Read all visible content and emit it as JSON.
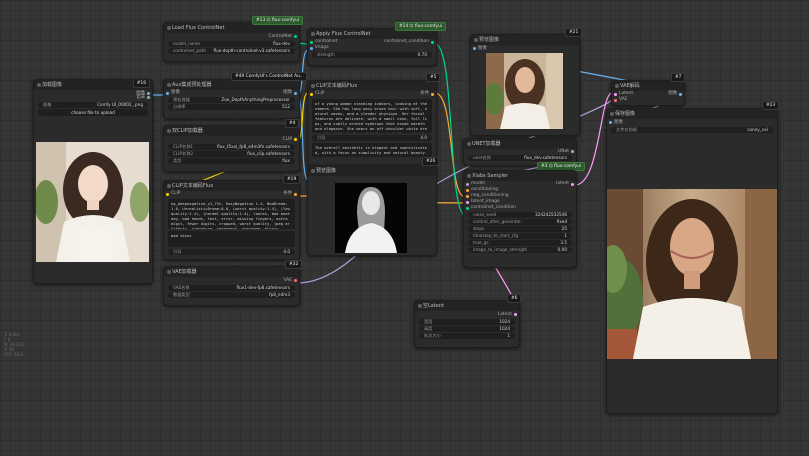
{
  "canvas": {
    "info_lines": [
      "T: 0.00s",
      "I: 0",
      "N: 16 [16]",
      "V: 46",
      "FPS: 58.8"
    ]
  },
  "nodes": {
    "load_image": {
      "title": "加载图像",
      "badge": "#16",
      "outputs": [
        "图像",
        "遮罩"
      ],
      "image_label": "图像",
      "image_value": "Comfy UI_00002_.png",
      "upload_label": "choose file to upload"
    },
    "load_controlnet": {
      "title": "Load Flux ControlNet",
      "badge": "#13 ⌬ flux-comfyui",
      "output": "ControlNet",
      "widgets": [
        {
          "label": "model_name",
          "value": "flux-dev"
        },
        {
          "label": "controlnet_path",
          "value": "flux-depth-controlnet-v3.safetensors"
        }
      ]
    },
    "aux_preprocessor": {
      "title": "Aux集成预处理器",
      "badge": "#49 ComfyUI's ControlNet Au..",
      "input": "图像",
      "output": "图像",
      "widgets": [
        {
          "label": "预处理器",
          "value": "Zoe_DepthAnythingPreprocessor"
        },
        {
          "label": "分辨率",
          "value": "512"
        }
      ]
    },
    "dual_clip": {
      "title": "双CLIP加载器",
      "badge": "#4",
      "output": "CLIP",
      "widgets": [
        {
          "label": "CLIP名称1",
          "value": "flux_t5xxl_fp8_e4m3fn.safetensors"
        },
        {
          "label": "CLIP名称2",
          "value": "flux_clip.safetensors"
        },
        {
          "label": "类型",
          "value": "flux"
        }
      ]
    },
    "clip_encode_neg": {
      "title": "CLIP文本编码Flux",
      "badge": "#19",
      "input": "CLIP",
      "output": "条件",
      "text1": "ng_deepnegative_v1_75t, EasyNegative 1.4, BadDream:1.0, UnrealisticDream:0.8, (worst quality:1.4), (low quality:1.4), (normal quality:1.4), lowres, bad anatomy, bad hands, text, error, missing fingers, extra digit, fewer digits, cropped, worst quality, jpeg artifacts, signature, watermark, username, blurry",
      "text2": "bad skins",
      "guidance_label": "引导",
      "guidance_value": "4.0"
    },
    "vae_loader": {
      "title": "VAE加载器",
      "badge": "#32",
      "output": "VAE",
      "widgets": [
        {
          "label": "VAE名称",
          "value": "flux1-dev-fp8.safetensors"
        },
        {
          "label": "数据类型",
          "value": "fp8_e4m3"
        }
      ]
    },
    "apply_controlnet": {
      "title": "Apply Flux ControlNet",
      "badge": "#14 ⌬ flux-comfyui",
      "inputs": [
        "controlnet",
        "image"
      ],
      "output": "controlnet_condition",
      "widget": {
        "label": "strength",
        "value": "0.70"
      }
    },
    "clip_encode_pos": {
      "title": "CLIP文本编码Flux",
      "badge": "#5",
      "input": "CLIP",
      "output": "条件",
      "text1": "of a young woman standing indoors, looking at the camera. She has long wavy brown hair with soft, natural waves, and a slender physique. Her facial features are delicate, with a small nose, full lips, and subtly arched eyebrows that exude warmth and elegance. She wears an off-shoulder white dress with delicate lace details, including a touch of pearl buttons",
      "text2": "The overall aesthetic is elegant and sophisticated, with a focus on simplicity and natural beauty.",
      "guidance_label": "引导",
      "guidance_value": "4.0"
    },
    "preview_depth": {
      "title": "预览图像",
      "badge": "#26"
    },
    "preview_top": {
      "title": "预览图像",
      "badge": "#21",
      "input": "图像"
    },
    "vae_decode": {
      "title": "VAE解码",
      "badge": "#7",
      "inputs": [
        "Latent",
        "VAE"
      ],
      "output": "图像"
    },
    "unet_loader": {
      "title": "UNET加载器",
      "badge": "#3 ⌬ flux-comfyui",
      "output": "UNet",
      "widget": {
        "label": "unet名称",
        "value": "flux_dev.safetensors"
      }
    },
    "xlabs_sampler": {
      "title": "Xlabs Sampler",
      "inputs": [
        "model",
        "conditioning",
        "neg_conditioning",
        "latent_image",
        "controlnet_condition"
      ],
      "output": "latent",
      "widgets": [
        {
          "label": "noise_seed",
          "value": "324242532546"
        },
        {
          "label": "control_after_generate",
          "value": "fixed"
        },
        {
          "label": "steps",
          "value": "25"
        },
        {
          "label": "timestep_to_start_cfg",
          "value": "1"
        },
        {
          "label": "true_gs",
          "value": "3.5"
        },
        {
          "label": "image_to_image_strength",
          "value": "0.00"
        }
      ]
    },
    "empty_latent": {
      "title": "空Latent",
      "badge": "#6",
      "output": "Latent",
      "widgets": [
        {
          "label": "宽度",
          "value": "1024"
        },
        {
          "label": "高度",
          "value": "1024"
        },
        {
          "label": "批次大小",
          "value": "1"
        }
      ]
    },
    "save_image": {
      "title": "保存图像",
      "badge": "#23",
      "input": "图像",
      "widget": {
        "label": "文件名前缀",
        "value": "canny_xxi"
      }
    }
  },
  "colors": {
    "image_link": "#64b5f6",
    "clip_link": "#ffd500",
    "cond_link": "#ffa931",
    "latent_link": "#ff9cf9",
    "vae_link": "#ff6e6e",
    "model_link": "#b39ddb",
    "controlnet_link": "#00d78d"
  }
}
